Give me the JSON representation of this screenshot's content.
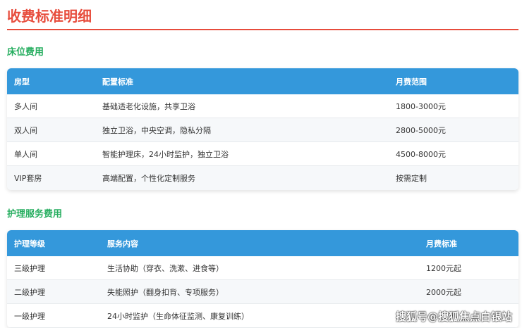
{
  "title": "收费标准明细",
  "bed": {
    "heading": "床位费用",
    "headers": [
      "房型",
      "配置标准",
      "月费范围"
    ],
    "rows": [
      [
        "多人间",
        "基础适老化设施，共享卫浴",
        "1800-3000元"
      ],
      [
        "双人间",
        "独立卫浴，中央空调，隐私分隔",
        "2800-5000元"
      ],
      [
        "单人间",
        "智能护理床，24小时监护，独立卫浴",
        "4500-8000元"
      ],
      [
        "VIP套房",
        "高端配置，个性化定制服务",
        "按需定制"
      ]
    ]
  },
  "care": {
    "heading": "护理服务费用",
    "headers": [
      "护理等级",
      "服务内容",
      "月费标准"
    ],
    "rows": [
      [
        "三级护理",
        "生活协助（穿衣、洗漱、进食等）",
        "1200元起"
      ],
      [
        "二级护理",
        "失能照护（翻身扣背、专项服务）",
        "2000元起"
      ],
      [
        "一级护理",
        "24小时监护（生命体征监测、康复训练）",
        ""
      ]
    ]
  },
  "watermark": "搜狐号@搜狐焦点白银站"
}
